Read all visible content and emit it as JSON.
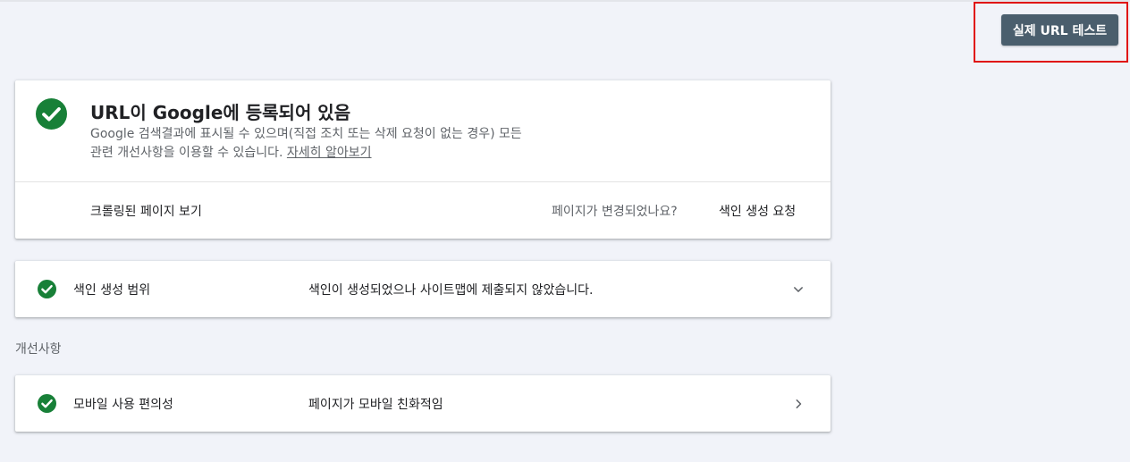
{
  "toolbar": {
    "live_test_label": "실제 URL 테스트"
  },
  "status_card": {
    "title": "URL이 Google에 등록되어 있음",
    "description_line1": "Google 검색결과에 표시될 수 있으며(직접 조치 또는 삭제 요청이 없는 경우) 모든",
    "description_line2": "관련 개선사항을 이용할 수 있습니다.",
    "learn_more": "자세히 알아보기",
    "view_crawled": "크롤링된 페이지 보기",
    "page_changed_question": "페이지가 변경되었나요?",
    "request_indexing": "색인 생성 요청",
    "icon": "check-circle-icon",
    "status_color": "#188038"
  },
  "coverage": {
    "label": "색인 생성 범위",
    "value": "색인이 생성되었으나 사이트맵에 제출되지 않았습니다.",
    "icon": "check-circle-icon",
    "expand_icon": "chevron-down-icon"
  },
  "enhancements": {
    "heading": "개선사항",
    "items": [
      {
        "label": "모바일 사용 편의성",
        "value": "페이지가 모바일 친화적임",
        "icon": "check-circle-icon",
        "nav_icon": "chevron-right-icon"
      }
    ]
  }
}
